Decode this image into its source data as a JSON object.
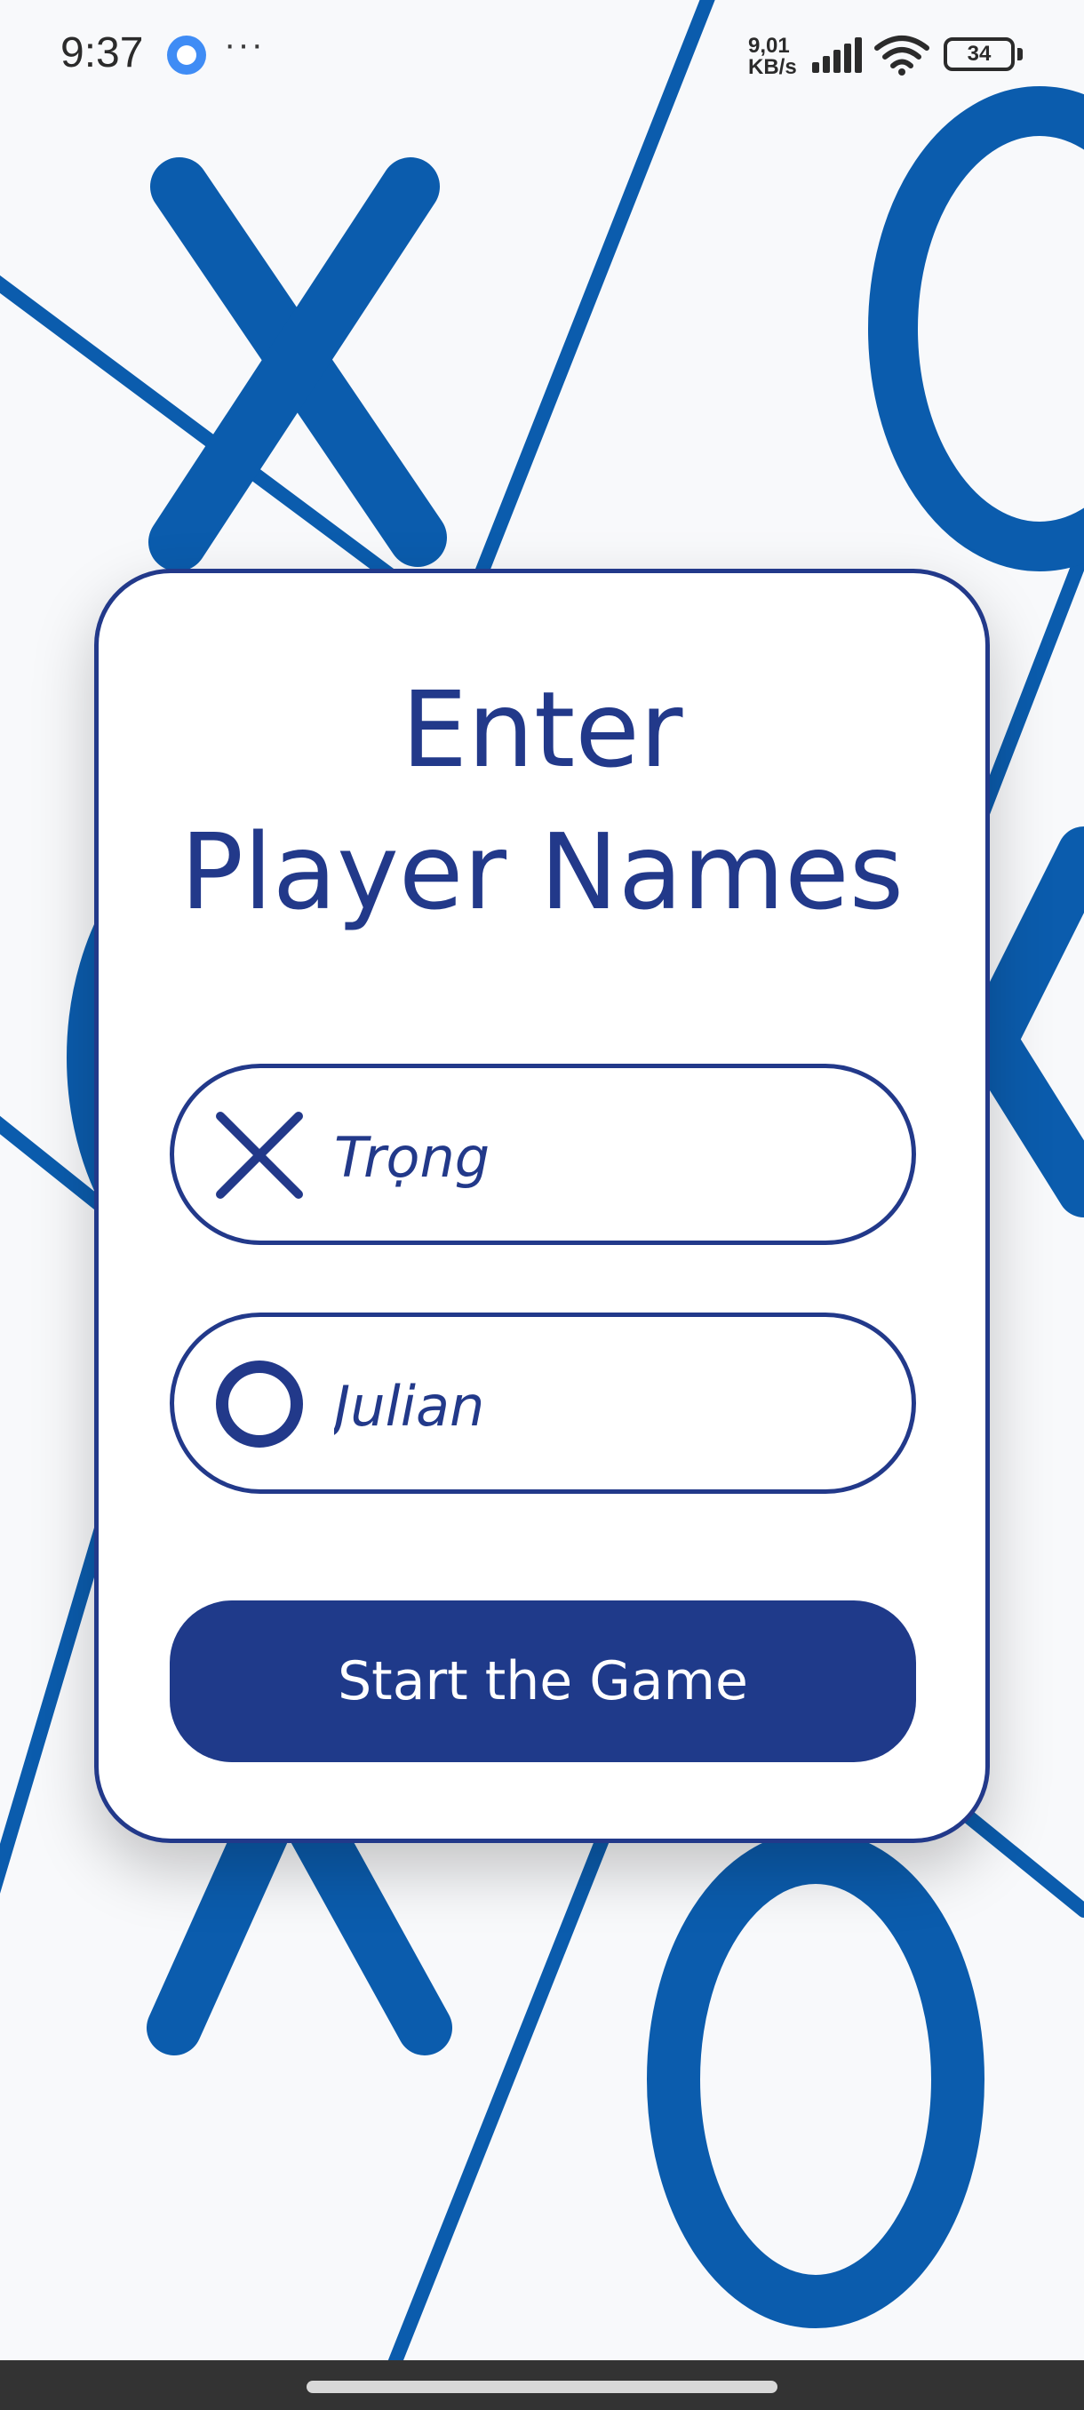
{
  "status_bar": {
    "time": "9:37",
    "more": "···",
    "speed_value": "9,01",
    "speed_unit": "KB/s",
    "battery": "34"
  },
  "card": {
    "title_line1": "Enter",
    "title_line2": "Player Names"
  },
  "players": [
    {
      "symbol": "x-icon",
      "name": "Trọng"
    },
    {
      "symbol": "o-icon",
      "name": "Julian"
    }
  ],
  "start_button": {
    "label": "Start the Game"
  },
  "colors": {
    "accent": "#22398a",
    "button": "#1f3a8a",
    "background_marks": "#0b5cad",
    "background": "#f8f9fb"
  }
}
